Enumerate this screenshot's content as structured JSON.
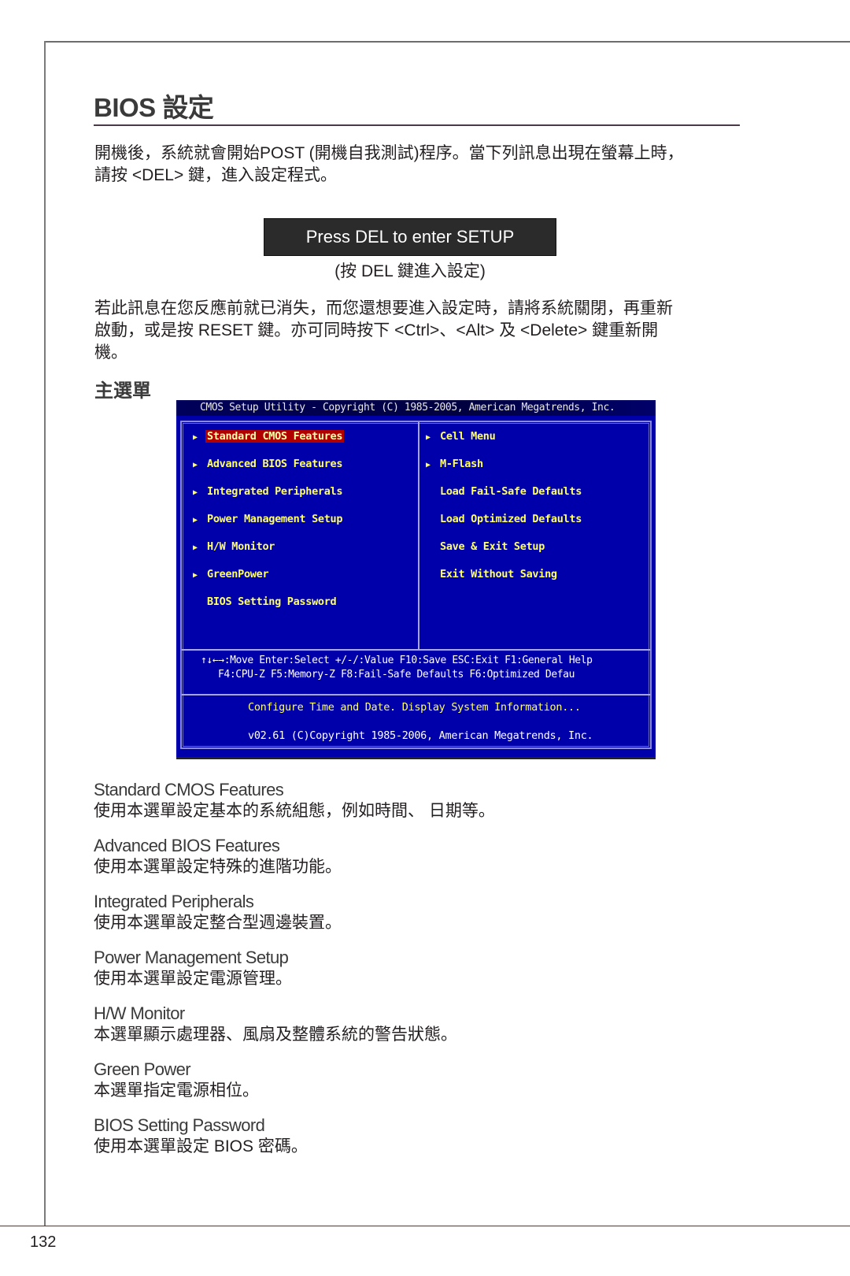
{
  "page": {
    "title": "BIOS 設定",
    "intro_lines": [
      "開機後，系統就會開始POST (開機自我測試)程序。當下列訊息出現在螢幕上時，",
      "請按 <DEL> 鍵，進入設定程式。"
    ],
    "press_box": "Press DEL to enter SETUP",
    "press_caption": "(按 DEL 鍵進入設定)",
    "reset_lines": [
      "若此訊息在您反應前就已消失，而您還想要進入設定時，請將系統關閉，再重新",
      "啟動，或是按 RESET 鍵。亦可同時按下 <Ctrl>、<Alt> 及 <Delete> 鍵重新開",
      "機。"
    ],
    "section_heading": "主選單",
    "page_number": "132"
  },
  "bios": {
    "title_bar": "CMOS Setup Utility - Copyright (C) 1985-2005, American Megatrends, Inc.",
    "arrow_glyph": "▶",
    "left_items": [
      {
        "label": "Standard CMOS Features",
        "arrow": true,
        "selected": true
      },
      {
        "label": "Advanced BIOS Features",
        "arrow": true,
        "selected": false
      },
      {
        "label": "Integrated Peripherals",
        "arrow": true,
        "selected": false
      },
      {
        "label": "Power Management Setup",
        "arrow": true,
        "selected": false
      },
      {
        "label": "H/W Monitor",
        "arrow": true,
        "selected": false
      },
      {
        "label": "GreenPower",
        "arrow": true,
        "selected": false
      },
      {
        "label": "BIOS Setting Password",
        "arrow": false,
        "selected": false
      }
    ],
    "right_items": [
      {
        "label": "Cell Menu",
        "arrow": true
      },
      {
        "label": "M-Flash",
        "arrow": true
      },
      {
        "label": "Load Fail-Safe Defaults",
        "arrow": false
      },
      {
        "label": "Load Optimized Defaults",
        "arrow": false
      },
      {
        "label": "Save & Exit Setup",
        "arrow": false
      },
      {
        "label": "Exit Without Saving",
        "arrow": false
      }
    ],
    "help_line1": "↑↓←→:Move  Enter:Select  +/-/:Value  F10:Save  ESC:Exit  F1:General Help",
    "help_line2": "F4:CPU-Z    F5:Memory-Z    F8:Fail-Safe Defaults    F6:Optimized Defau",
    "status_text": "Configure Time and Date.  Display System Information...",
    "version_text": "v02.61 (C)Copyright 1985-2006, American Megatrends, Inc.",
    "colors": {
      "background": "#0000aa",
      "item_text": "#ffff66",
      "selected_bg": "#b00000"
    }
  },
  "descriptions": [
    {
      "title": "Standard CMOS Features",
      "text": "使用本選單設定基本的系統組態，例如時間、 日期等。"
    },
    {
      "title": "Advanced BIOS Features",
      "text": "使用本選單設定特殊的進階功能。"
    },
    {
      "title": "Integrated Peripherals",
      "text": "使用本選單設定整合型週邊裝置。"
    },
    {
      "title": "Power Management Setup",
      "text": "使用本選單設定電源管理。"
    },
    {
      "title": "H/W Monitor",
      "text": "本選單顯示處理器、風扇及整體系統的警告狀態。"
    },
    {
      "title": "Green Power",
      "text": "本選單指定電源相位。"
    },
    {
      "title": "BIOS Setting Password",
      "text": "使用本選單設定 BIOS 密碼。"
    }
  ]
}
